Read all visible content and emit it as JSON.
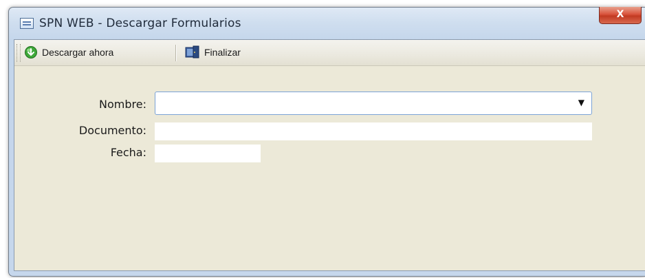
{
  "window": {
    "title": "SPN WEB - Descargar Formularios",
    "close_label": "X",
    "title_icon": "window-form-icon",
    "close_icon": "close-icon"
  },
  "toolbar": {
    "download_label": "Descargar ahora",
    "download_icon": "download-globe-icon",
    "finish_label": "Finalizar",
    "finish_icon": "finish-exit-icon"
  },
  "form": {
    "nombre_label": "Nombre:",
    "nombre_value": "",
    "documento_label": "Documento:",
    "documento_value": "",
    "fecha_label": "Fecha:",
    "fecha_value": ""
  },
  "colors": {
    "client_background": "#ece9d8",
    "window_frame": "#c6d7ec",
    "close_button": "#d9533c",
    "combo_border": "#7aa2d6"
  }
}
